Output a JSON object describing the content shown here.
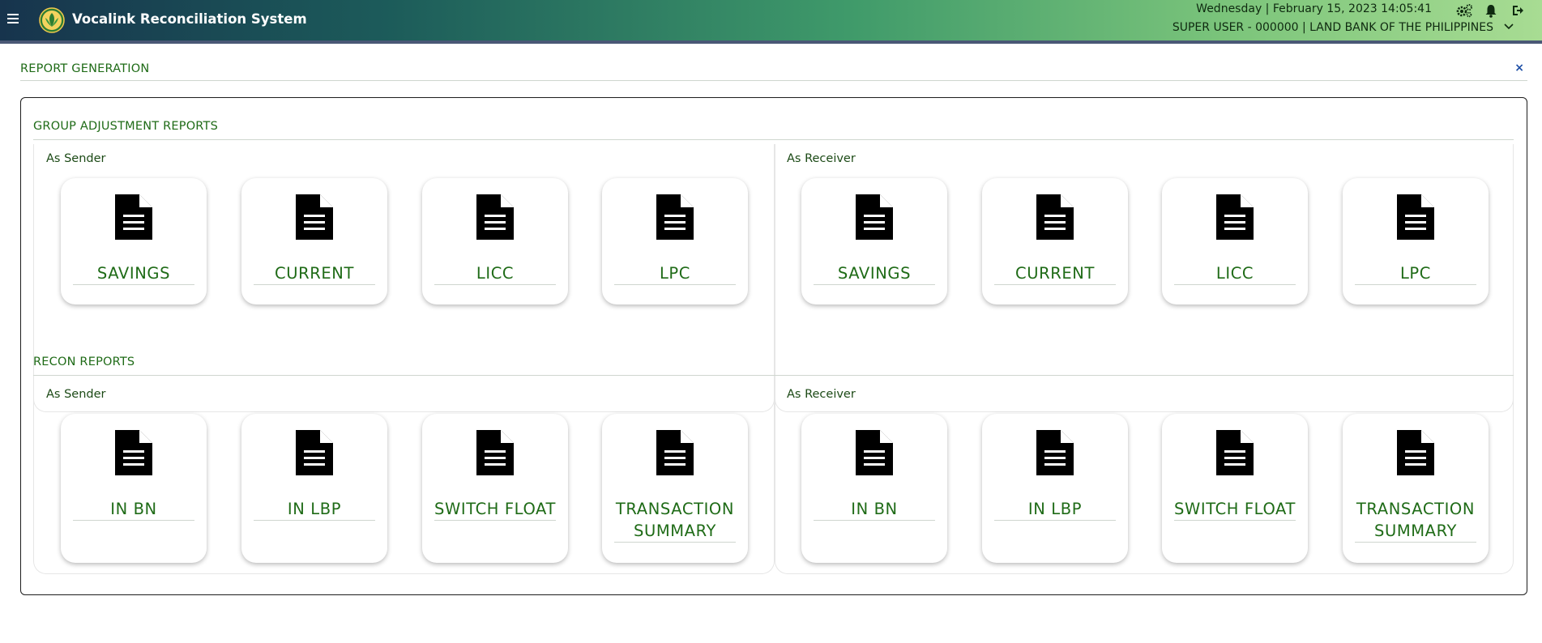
{
  "app": {
    "title": "Vocalink Reconciliation System",
    "datetime": "Wednesday | February 15, 2023 14:05:41",
    "user": "SUPER USER - 000000 | LAND BANK OF THE PHILIPPINES",
    "icons": [
      "menu-icon",
      "logo-icon",
      "settings-icon",
      "bell-icon",
      "logout-icon",
      "chevron-down-icon"
    ]
  },
  "page": {
    "title": "REPORT GENERATION",
    "close": "×"
  },
  "sections": {
    "group_adjustment": {
      "title": "GROUP ADJUSTMENT REPORTS",
      "sender_label": "As Sender",
      "receiver_label": "As Receiver",
      "sender": [
        "SAVINGS",
        "CURRENT",
        "LICC",
        "LPC"
      ],
      "receiver": [
        "SAVINGS",
        "CURRENT",
        "LICC",
        "LPC"
      ]
    },
    "recon": {
      "title": "RECON REPORTS",
      "sender_label": "As Sender",
      "receiver_label": "As Receiver",
      "sender": [
        "IN BN",
        "IN LBP",
        "SWITCH FLOAT",
        "TRANSACTION SUMMARY"
      ],
      "receiver": [
        "IN BN",
        "IN LBP",
        "SWITCH FLOAT",
        "TRANSACTION SUMMARY"
      ]
    }
  },
  "colors": {
    "accent_green": "#1f6b17",
    "header_dark": "#17344d",
    "header_light": "#a8dc93",
    "close_blue": "#1e4fa6"
  }
}
